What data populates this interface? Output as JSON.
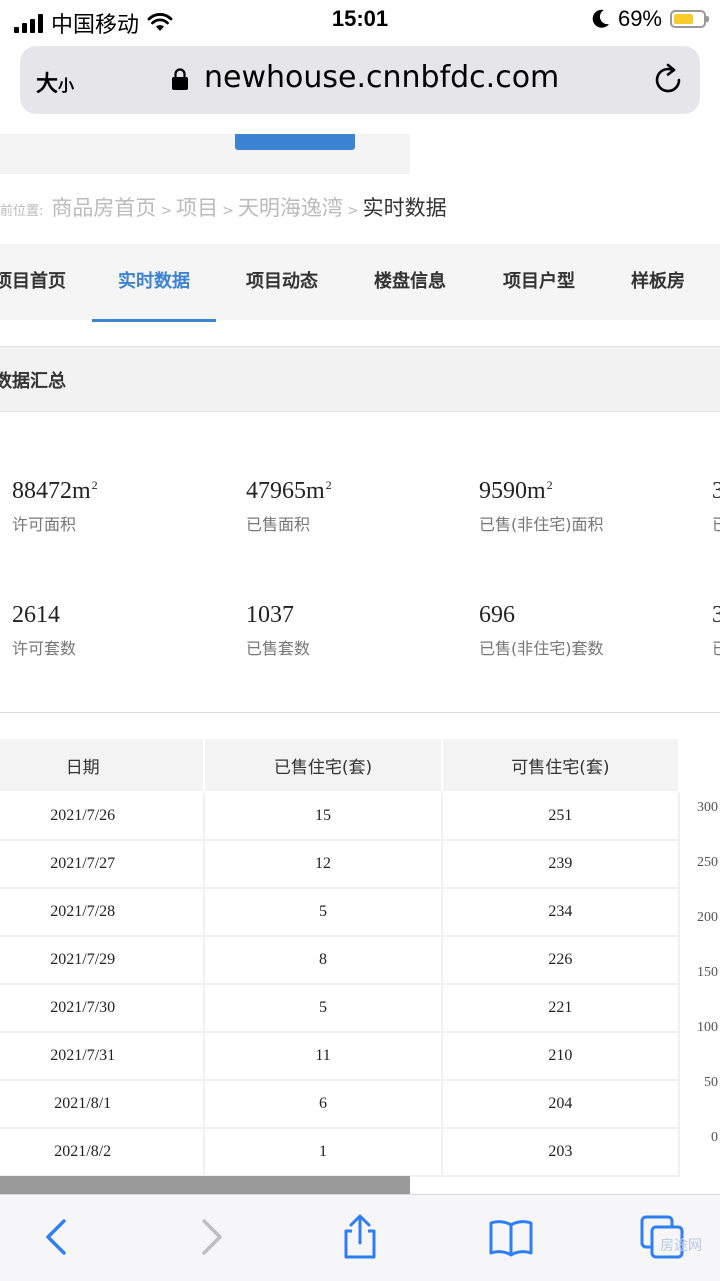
{
  "status_bar": {
    "carrier": "中国移动",
    "time": "15:01",
    "battery": "69%",
    "battery_level": 0.69
  },
  "browser": {
    "text_size_label": "大",
    "text_size_small": "小",
    "url": "newhouse.cnnbfdc.com"
  },
  "breadcrumb": {
    "label": "前位置:",
    "items": [
      "商品房首页",
      "项目",
      "天明海逸湾"
    ],
    "current": "实时数据"
  },
  "tabs": [
    "项目首页",
    "实时数据",
    "项目动态",
    "楼盘信息",
    "项目户型",
    "样板房"
  ],
  "active_tab": 1,
  "summary_title": "数据汇总",
  "stats": [
    {
      "value": "88472m",
      "unit": "2",
      "label": "许可面积"
    },
    {
      "value": "47965m",
      "unit": "2",
      "label": "已售面积"
    },
    {
      "value": "9590m",
      "unit": "2",
      "label": "已售(非住宅)面积"
    },
    {
      "value": "3",
      "unit": "",
      "label": "已"
    },
    {
      "value": "2614",
      "unit": "",
      "label": "许可套数"
    },
    {
      "value": "1037",
      "unit": "",
      "label": "已售套数"
    },
    {
      "value": "696",
      "unit": "",
      "label": "已售(非住宅)套数"
    },
    {
      "value": "3",
      "unit": "",
      "label": "已"
    }
  ],
  "table": {
    "headers": [
      "日期",
      "已售住宅(套)",
      "可售住宅(套)"
    ],
    "rows": [
      [
        "2021/7/26",
        "15",
        "251"
      ],
      [
        "2021/7/27",
        "12",
        "239"
      ],
      [
        "2021/7/28",
        "5",
        "234"
      ],
      [
        "2021/7/29",
        "8",
        "226"
      ],
      [
        "2021/7/30",
        "5",
        "221"
      ],
      [
        "2021/7/31",
        "11",
        "210"
      ],
      [
        "2021/8/1",
        "6",
        "204"
      ],
      [
        "2021/8/2",
        "1",
        "203"
      ]
    ]
  },
  "chart_axis_ticks": [
    "300",
    "250",
    "200",
    "150",
    "100",
    "50",
    "0"
  ],
  "watermark": "房途网"
}
